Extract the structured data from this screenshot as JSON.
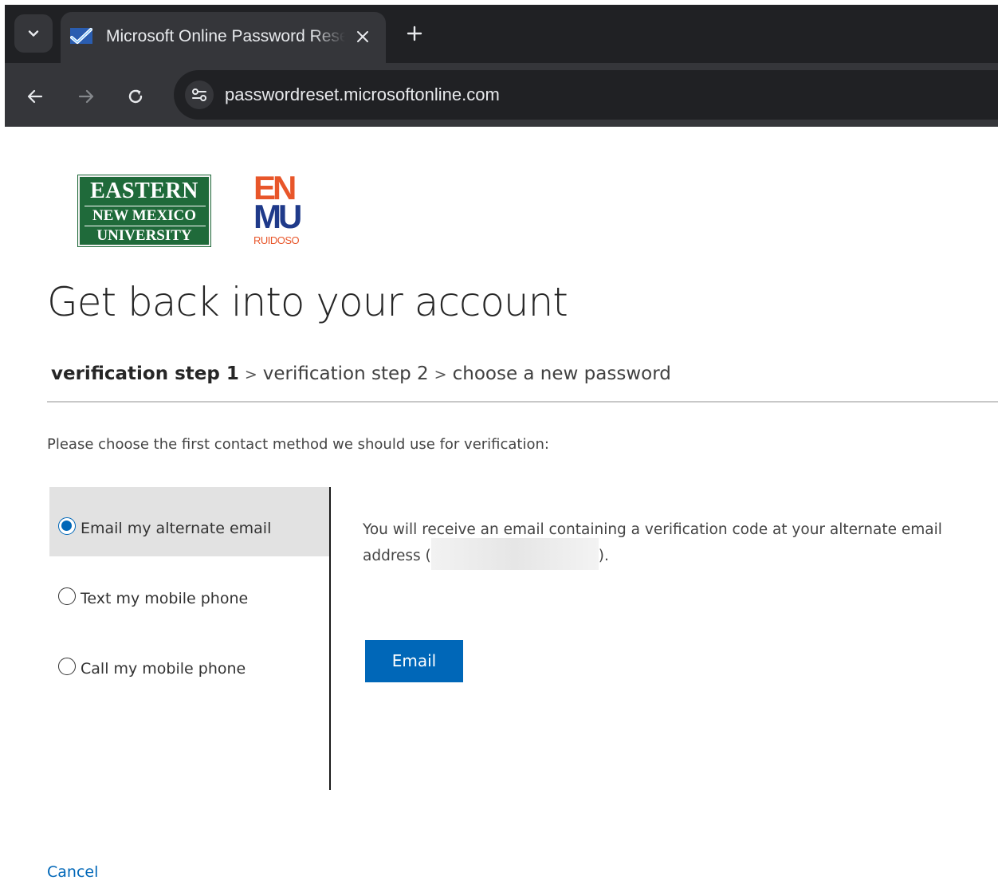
{
  "browser": {
    "tab": {
      "title": "Microsoft Online Password Reset",
      "favicon": "microsoft-password-reset-icon"
    },
    "address_bar": {
      "url": "passwordreset.microsoftonline.com"
    },
    "icons": {
      "tab_menu": "chevron-down-icon",
      "close": "close-icon",
      "new_tab": "plus-icon",
      "back": "arrow-left-icon",
      "forward": "arrow-right-icon",
      "reload": "reload-icon",
      "site_info": "tune-icon"
    },
    "colors": {
      "frame": "#202124",
      "toolbar": "#35363a",
      "text": "#e8eaed"
    }
  },
  "logos": {
    "eastern": {
      "line1": "EASTERN",
      "line2": "NEW MEXICO",
      "line3": "UNIVERSITY",
      "color": "#1f6a3a"
    },
    "enmu": {
      "row1": "EN",
      "row2": "MU",
      "sub": "RUIDOSO",
      "colors": {
        "orange": "#e8562a",
        "blue": "#1f3a8a"
      }
    }
  },
  "page": {
    "title": "Get back into your account",
    "steps": [
      {
        "label": "verification step 1",
        "active": true
      },
      {
        "label": "verification step 2",
        "active": false
      },
      {
        "label": "choose a new password",
        "active": false
      }
    ],
    "step_separator": ">",
    "instructions": "Please choose the first contact method we should use for verification:",
    "options": [
      {
        "label": "Email my alternate email",
        "selected": true
      },
      {
        "label": "Text my mobile phone",
        "selected": false
      },
      {
        "label": "Call my mobile phone",
        "selected": false
      }
    ],
    "detail": {
      "text_before": "You will receive an email containing a verification code at your alternate email address (",
      "text_after": ")."
    },
    "email_button": "Email",
    "cancel_link": "Cancel",
    "accent_color": "#0067b8"
  }
}
